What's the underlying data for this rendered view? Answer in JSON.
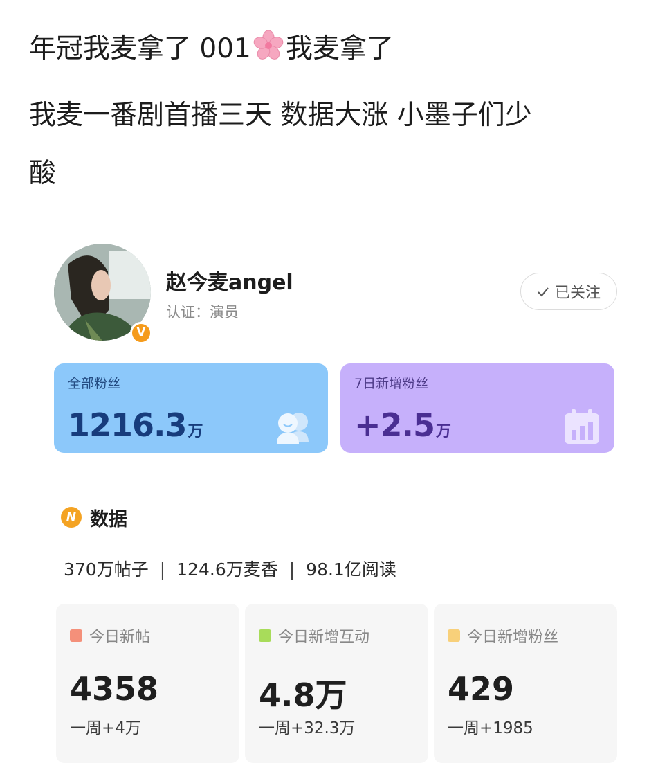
{
  "post": {
    "line1_a": "年冠我麦拿了 001",
    "line1_b": "我麦拿了",
    "line2": "我麦一番剧首播三天 数据大涨 小墨子们少",
    "line3": "酸"
  },
  "profile": {
    "name": "赵今麦angel",
    "verification": "认证：演员",
    "badge": "V",
    "follow_label": "已关注"
  },
  "stats": {
    "total_fans_label": "全部粉丝",
    "total_fans_value": "1216.3",
    "total_fans_unit": "万",
    "new_fans_label": "7日新增粉丝",
    "new_fans_value": "+2.5",
    "new_fans_unit": "万"
  },
  "data_section": {
    "icon_letter": "N",
    "title": "数据",
    "posts": "370万帖子",
    "fans": "124.6万麦香",
    "reads": "98.1亿阅读",
    "separator": "|"
  },
  "metrics": [
    {
      "label": "今日新帖",
      "value": "4358",
      "week": "一周+4万",
      "color": "#f4907a"
    },
    {
      "label": "今日新增互动",
      "value": "4.8万",
      "week": "一周+32.3万",
      "color": "#a8dc5a"
    },
    {
      "label": "今日新增粉丝",
      "value": "429",
      "week": "一周+1985",
      "color": "#f8d07a"
    }
  ]
}
